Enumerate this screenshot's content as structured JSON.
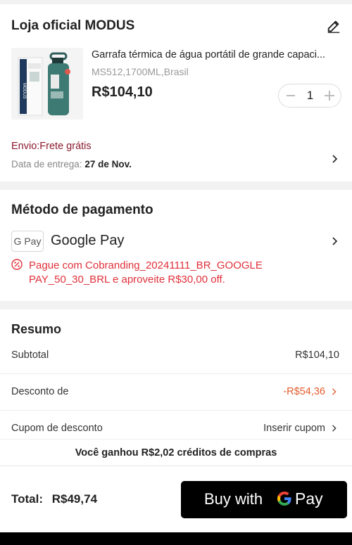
{
  "store": {
    "name": "Loja oficial MODUS",
    "product": {
      "title": "Garrafa térmica de água portátil de grande capaci...",
      "variant": "MS512,1700ML,Brasil",
      "price": "R$104,10",
      "quantity": "1",
      "image_brand": "MODUS"
    },
    "shipping_label": "Envio:Frete grátis",
    "delivery_label": "Data de entrega:",
    "delivery_date": "27 de Nov."
  },
  "payment": {
    "title": "Método de pagamento",
    "badge": "G Pay",
    "method": "Google Pay",
    "promo": "Pague com Cobranding_20241111_BR_GOOGLE PAY_50_30_BRL e aproveite R$30,00 off."
  },
  "summary": {
    "title": "Resumo",
    "subtotal_label": "Subtotal",
    "subtotal_value": "R$104,10",
    "discount_label": "Desconto de",
    "discount_value": "-R$54,36",
    "coupon_label": "Cupom de desconto",
    "coupon_value": "Inserir cupom"
  },
  "credits": "Você ganhou R$2,02 créditos de compras",
  "footer": {
    "total_label": "Total:",
    "total_value": "R$49,74",
    "buy_label": "Buy with",
    "buy_pay": "Pay"
  },
  "colors": {
    "shipping": "#8b1a2e",
    "promo": "#e0303a",
    "discount": "#e25c2d",
    "button": "#000000"
  }
}
